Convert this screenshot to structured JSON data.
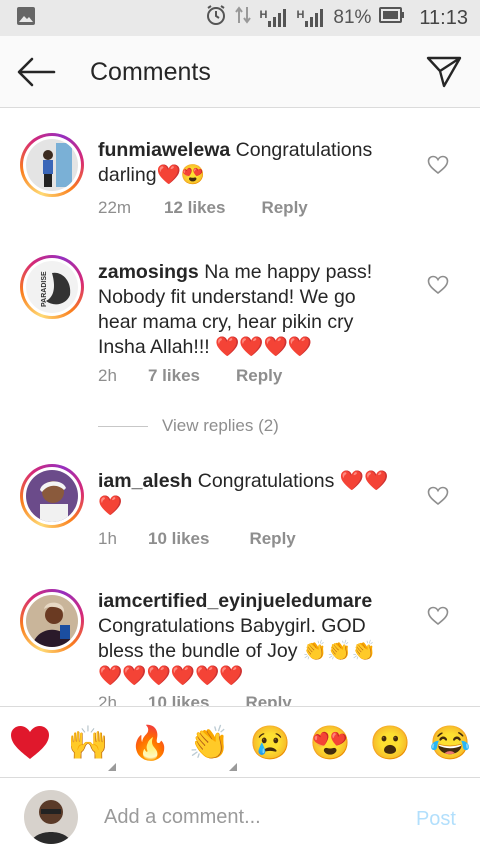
{
  "status_bar": {
    "network_1": "H",
    "network_2": "H",
    "battery_percent": "81%",
    "time": "11:13",
    "icons": [
      "gallery-icon",
      "alarm-icon",
      "data-transfer-icon",
      "signal-icon",
      "signal-icon",
      "battery-icon"
    ]
  },
  "header": {
    "title": "Comments",
    "back_icon": "back-arrow-icon",
    "send_icon": "direct-send-icon"
  },
  "comments": [
    {
      "username": "funmiawelewa",
      "text": "Congratulations darling",
      "emojis": "❤️😍",
      "time": "22m",
      "likes": "12 likes",
      "reply": "Reply"
    },
    {
      "username": "zamosings",
      "text": "Na me happy pass! Nobody fit understand! We go hear mama cry, hear pikin cry Insha Allah!!!",
      "emojis": "❤️❤️❤️❤️",
      "time": "2h",
      "likes": "7 likes",
      "reply": "Reply",
      "avatar_text": "PARADISE"
    },
    {
      "username": "iam_alesh",
      "text": "Congratulations",
      "emojis": "❤️❤️❤️",
      "time": "1h",
      "likes": "10 likes",
      "reply": "Reply"
    },
    {
      "username": "iamcertified_eyinjueledumare",
      "text": "Congratulations Babygirl. GOD bless the bundle of Joy",
      "emojis": "👏👏👏❤️❤️❤️❤️❤️❤️",
      "time": "2h",
      "likes": "10 likes",
      "reply": "Reply"
    }
  ],
  "view_replies": "View replies (2)",
  "emoji_bar": [
    "❤️",
    "🙌",
    "🔥",
    "👏",
    "😢",
    "😍",
    "😮",
    "😂"
  ],
  "input": {
    "placeholder": "Add a comment...",
    "post_label": "Post"
  },
  "colors": {
    "post_disabled": "#b2dffc",
    "muted_text": "#8e8e8e",
    "text": "#262626"
  }
}
